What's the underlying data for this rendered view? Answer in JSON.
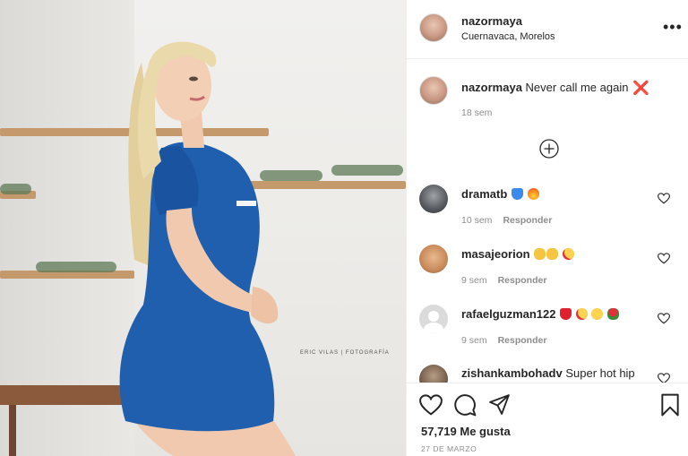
{
  "post": {
    "username": "nazormaya",
    "location": "Cuernavaca, Morelos",
    "photo_watermark": "ERIC VILAS | FOTOGRAFÍA"
  },
  "caption": {
    "username": "nazormaya",
    "text": "Never call me again",
    "emoji": "❌",
    "time": "18 sem"
  },
  "comments": [
    {
      "username": "dramatb",
      "text": "",
      "emojis": [
        "blue-heart",
        "fire"
      ],
      "time": "10 sem",
      "reply_label": "Responder",
      "avatar": "dark"
    },
    {
      "username": "masajeorion",
      "text": "",
      "emojis": [
        "ok-hand",
        "ok-hand",
        "heart-eyes"
      ],
      "time": "9 sem",
      "reply_label": "Responder",
      "avatar": "tan"
    },
    {
      "username": "rafaelguzman122",
      "text": "",
      "emojis": [
        "red-heart",
        "heart-eyes",
        "yum",
        "rose"
      ],
      "time": "9 sem",
      "reply_label": "Responder",
      "avatar": "default"
    },
    {
      "username": "zishankambohadv",
      "text": "Super hot hip",
      "emojis": [],
      "time": "",
      "reply_label": "",
      "avatar": "brown"
    }
  ],
  "likes_text": "57,719 Me gusta",
  "date": "27 DE MARZO",
  "colors": {
    "dress": "#1f5fae",
    "hair": "#e8d7a8",
    "skin": "#f0c9ae",
    "text": "#262626",
    "muted": "#8e8e8e",
    "divider": "#efefef"
  },
  "icons": [
    "more-options-icon",
    "add-circle-icon",
    "like-icon",
    "comment-icon",
    "share-icon",
    "save-icon"
  ]
}
